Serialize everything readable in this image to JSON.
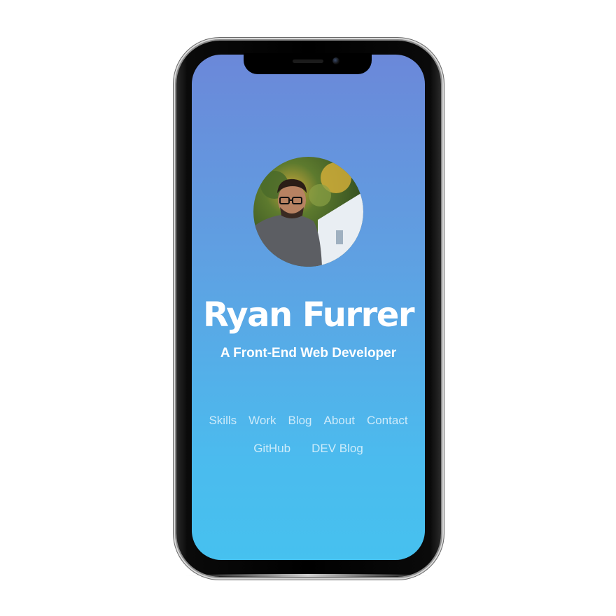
{
  "profile": {
    "name": "Ryan Furrer",
    "tagline": "A Front-End Web Developer",
    "avatar_icon": "profile-photo"
  },
  "nav": {
    "primary": [
      {
        "label": "Skills"
      },
      {
        "label": "Work"
      },
      {
        "label": "Blog"
      },
      {
        "label": "About"
      },
      {
        "label": "Contact"
      }
    ],
    "secondary": [
      {
        "label": "GitHub"
      },
      {
        "label": "DEV Blog"
      }
    ]
  },
  "colors": {
    "gradient_top": "#6b88d9",
    "gradient_bottom": "#46c1ef",
    "text": "#ffffff"
  }
}
